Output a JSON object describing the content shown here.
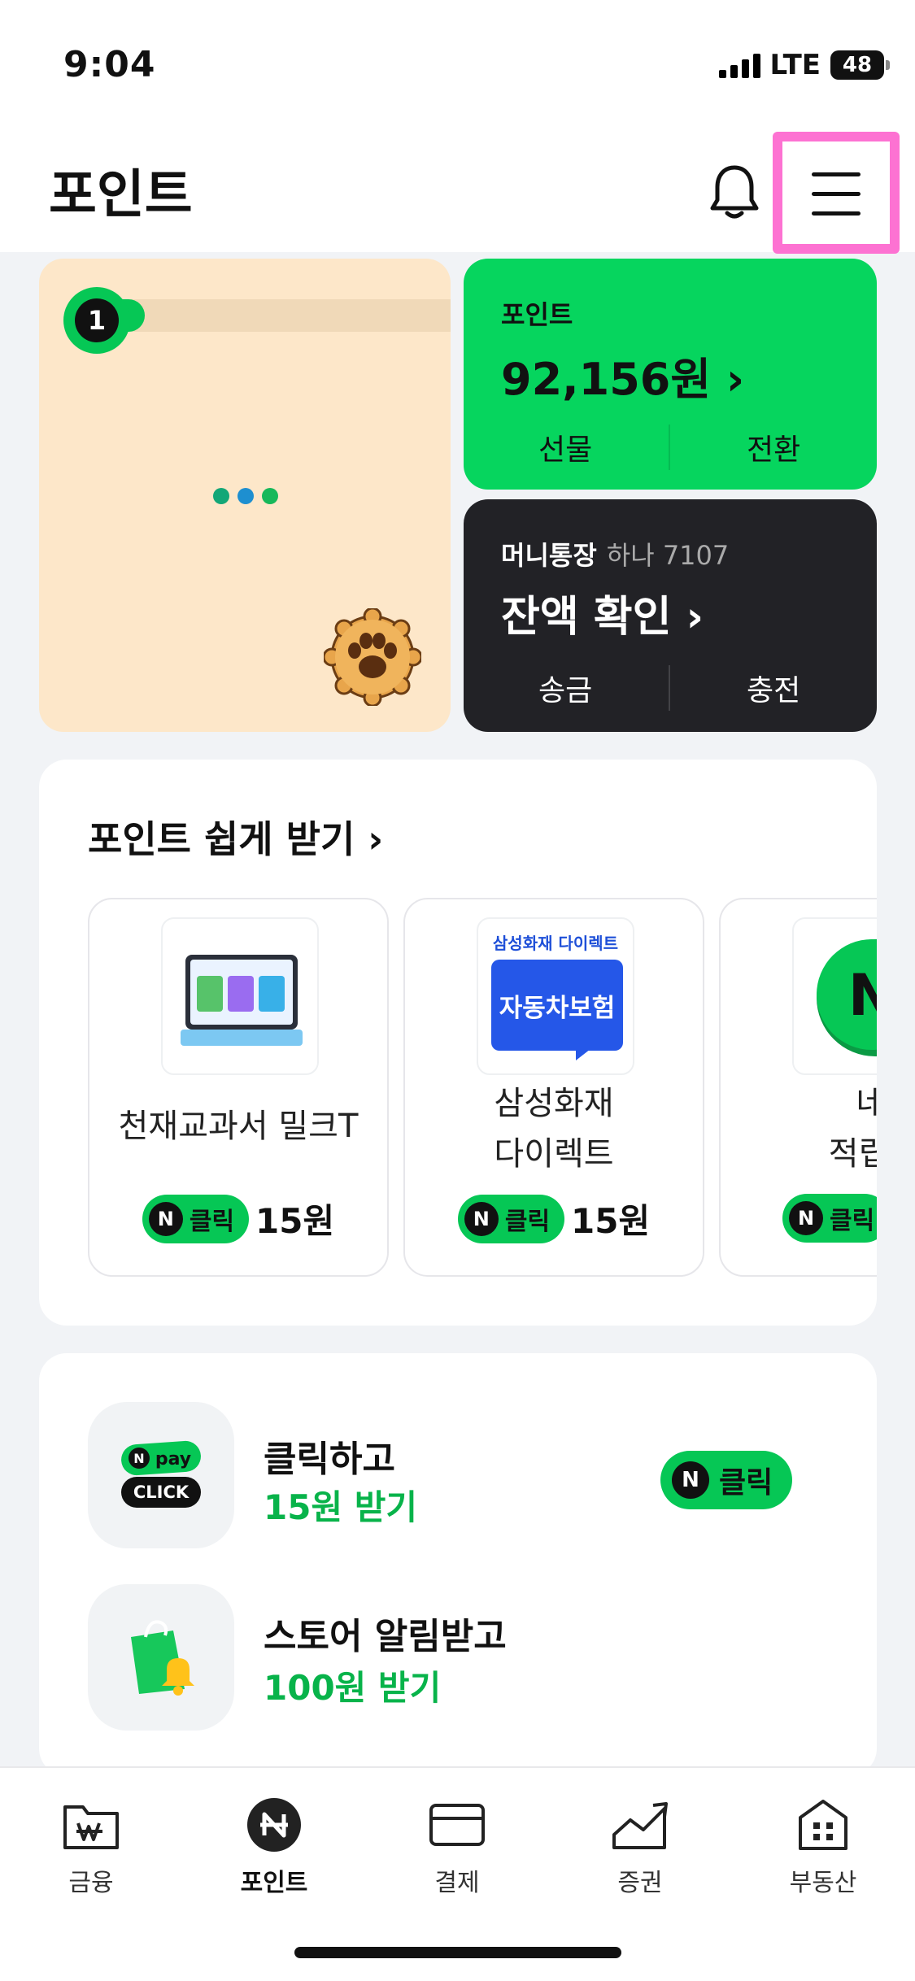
{
  "status_bar": {
    "time": "9:04",
    "network": "LTE",
    "battery": "48"
  },
  "header": {
    "title": "포인트"
  },
  "game_card": {
    "level": "1"
  },
  "point_card": {
    "label": "포인트",
    "amount": "92,156원 ›",
    "action_left": "선물",
    "action_right": "전환"
  },
  "money_card": {
    "title": "머니통장",
    "subtitle": "하나 7107",
    "balance_label": "잔액 확인 ›",
    "action_left": "송금",
    "action_right": "충전"
  },
  "easy_points": {
    "title": "포인트 쉽게 받기 ›",
    "offers": [
      {
        "name_line1": "천재교과서 밀크T",
        "name_line2": "",
        "pill": "클릭",
        "reward": "15원"
      },
      {
        "img_brand": "삼성화재 다이렉트",
        "img_text": "자동차보험",
        "name_line1": "삼성화재",
        "name_line2": "다이렉트",
        "pill": "클릭",
        "reward": "15원"
      },
      {
        "name_line1": "네플",
        "name_line2": "적립챌",
        "pill": "클릭",
        "reward": ""
      }
    ]
  },
  "list": {
    "items": [
      {
        "title": "클릭하고",
        "subtitle": "15원 받기",
        "icon_top": "pay",
        "icon_bottom": "CLICK",
        "button": "클릭"
      },
      {
        "title": "스토어 알림받고",
        "subtitle": "100원 받기"
      }
    ]
  },
  "bottom_nav": [
    {
      "label": "금융"
    },
    {
      "label": "포인트"
    },
    {
      "label": "결제"
    },
    {
      "label": "증권"
    },
    {
      "label": "부동산"
    }
  ],
  "colors": {
    "brand_green": "#06C755",
    "card_dark": "#222226",
    "highlight": "#FD72D2",
    "game_bg": "#FDE7C9"
  },
  "icons": [
    "bell-icon",
    "menu-icon",
    "chevron-right-icon",
    "n-logo-icon",
    "won-folder-icon",
    "card-icon",
    "chart-icon",
    "building-icon"
  ]
}
